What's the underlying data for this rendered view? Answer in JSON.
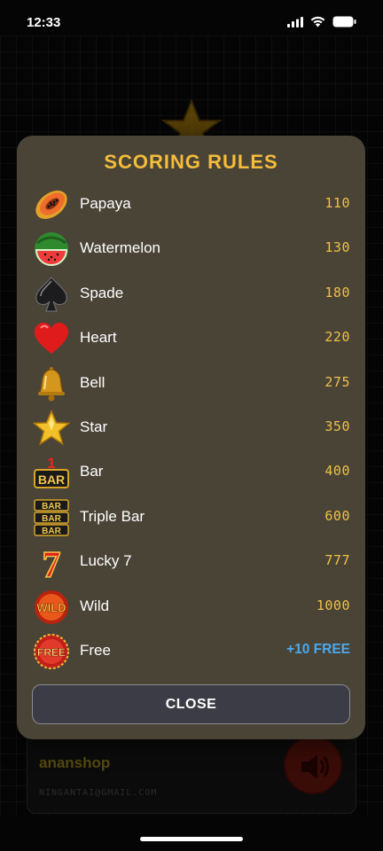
{
  "status_bar": {
    "time": "12:33"
  },
  "background": {
    "shop_name": "ananshop",
    "email": "NINGANTAI@GMAIL.COM"
  },
  "modal": {
    "title": "SCORING RULES",
    "rules": [
      {
        "name": "Papaya",
        "score": "110",
        "icon": "papaya-icon"
      },
      {
        "name": "Watermelon",
        "score": "130",
        "icon": "watermelon-icon"
      },
      {
        "name": "Spade",
        "score": "180",
        "icon": "spade-icon"
      },
      {
        "name": "Heart",
        "score": "220",
        "icon": "heart-icon"
      },
      {
        "name": "Bell",
        "score": "275",
        "icon": "bell-icon"
      },
      {
        "name": "Star",
        "score": "350",
        "icon": "star-icon"
      },
      {
        "name": "Bar",
        "score": "400",
        "icon": "bar-icon"
      },
      {
        "name": "Triple Bar",
        "score": "600",
        "icon": "triple-bar-icon"
      },
      {
        "name": "Lucky 7",
        "score": "777",
        "icon": "lucky-7-icon"
      },
      {
        "name": "Wild",
        "score": "1000",
        "icon": "wild-icon"
      },
      {
        "name": "Free",
        "score": "+10 FREE",
        "icon": "free-icon"
      }
    ],
    "close_label": "CLOSE"
  },
  "colors": {
    "title": "#f4bd3a",
    "score": "#f0c046",
    "bonus": "#4aa9ee",
    "modal_bg": "#4a4437"
  }
}
